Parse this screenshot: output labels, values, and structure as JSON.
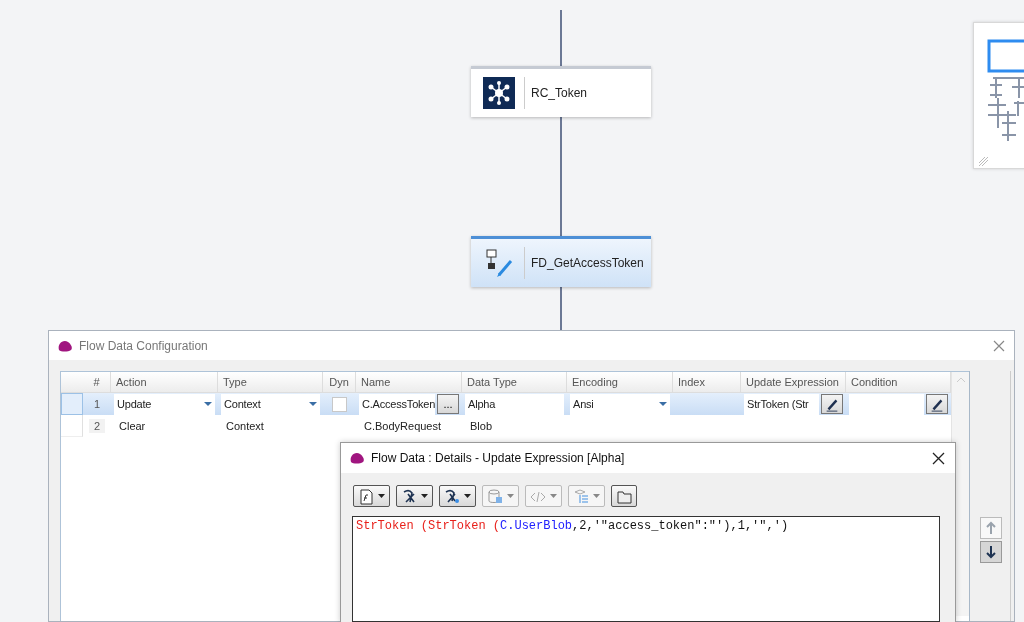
{
  "canvas": {
    "nodes": [
      {
        "label": "RC_Token",
        "kind": "service",
        "selected": false
      },
      {
        "label": "FD_GetAccessToken",
        "kind": "flow-data",
        "selected": true
      }
    ]
  },
  "config_dialog": {
    "title": "Flow Data Configuration",
    "grid": {
      "columns": [
        "#",
        "Action",
        "Type",
        "Dyn",
        "Name",
        "Data Type",
        "Encoding",
        "Index",
        "Update Expression",
        "Condition"
      ],
      "rows": [
        {
          "selected": true,
          "cells": [
            {
              "kind": "number",
              "value": "1"
            },
            {
              "kind": "dropdown",
              "value": "Update"
            },
            {
              "kind": "dropdown",
              "value": "Context"
            },
            {
              "kind": "checkbox",
              "checked": false
            },
            {
              "kind": "field-browse",
              "value": "C.AccessToken",
              "button": "..."
            },
            {
              "kind": "field",
              "value": "Alpha"
            },
            {
              "kind": "dropdown",
              "value": "Ansi"
            },
            {
              "kind": "empty"
            },
            {
              "kind": "field-edit",
              "value": "StrToken (Str"
            },
            {
              "kind": "field-edit"
            }
          ]
        },
        {
          "selected": false,
          "cells": [
            {
              "kind": "number",
              "value": "2"
            },
            {
              "kind": "text",
              "value": "Clear"
            },
            {
              "kind": "text",
              "value": "Context"
            },
            {
              "kind": "empty"
            },
            {
              "kind": "text",
              "value": "C.BodyRequest"
            },
            {
              "kind": "text",
              "value": "Blob"
            },
            {
              "kind": "empty"
            },
            {
              "kind": "empty"
            },
            {
              "kind": "empty"
            },
            {
              "kind": "empty"
            }
          ]
        }
      ]
    },
    "move_buttons": [
      {
        "kind": "up",
        "disabled": true
      },
      {
        "kind": "down",
        "disabled": false
      }
    ]
  },
  "details_dialog": {
    "title": "Flow Data : Details - Update Expression [Alpha]",
    "toolbar": [
      {
        "kind": "document",
        "disabled": false
      },
      {
        "kind": "function",
        "disabled": false
      },
      {
        "kind": "variable",
        "disabled": false
      },
      {
        "kind": "database",
        "disabled": true
      },
      {
        "kind": "code",
        "disabled": true
      },
      {
        "kind": "tree",
        "disabled": true
      },
      {
        "kind": "folder",
        "disabled": false
      }
    ],
    "expression": [
      {
        "kind": "function",
        "text": "StrToken (StrToken ("
      },
      {
        "kind": "variable",
        "text": "C.UserBlob"
      },
      {
        "kind": "plain",
        "text": ",2,'\"access_token\":\"'),1,'\",')"
      }
    ]
  }
}
